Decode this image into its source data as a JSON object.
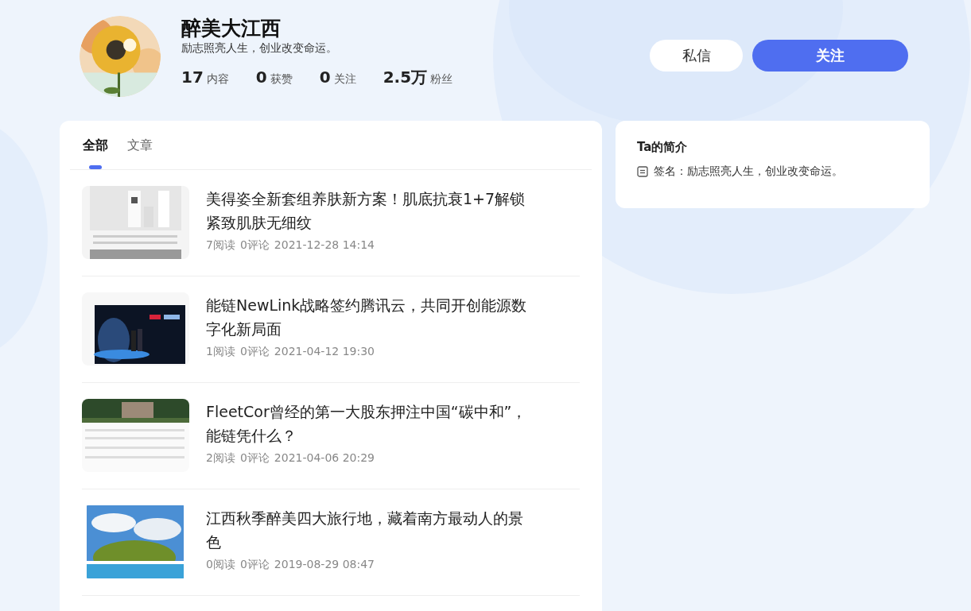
{
  "profile": {
    "name": "醉美大江西",
    "bio": "励志照亮人生，创业改变命运。",
    "stats": [
      {
        "value": "17",
        "label": "内容"
      },
      {
        "value": "0",
        "label": "获赞"
      },
      {
        "value": "0",
        "label": "关注"
      },
      {
        "value": "2.5万",
        "label": "粉丝"
      }
    ],
    "buttons": [
      {
        "label": "私信",
        "kind": "secondary"
      },
      {
        "label": "关注",
        "kind": "primary"
      }
    ]
  },
  "tabs": [
    {
      "label": "全部",
      "selected": true
    },
    {
      "label": "文章",
      "selected": false
    }
  ],
  "articles": [
    {
      "title": "美得姿全新套组养肤新方案！肌底抗衰1+7解锁紧致肌肤无细纹",
      "reads": "7阅读",
      "comments": "0评论",
      "time": "2021-12-28 14:14"
    },
    {
      "title": "能链NewLink战略签约腾讯云，共同开创能源数字化新局面",
      "reads": "1阅读",
      "comments": "0评论",
      "time": "2021-04-12 19:30"
    },
    {
      "title": "FleetCor曾经的第一大股东押注中国“碳中和”，能链凭什么？",
      "reads": "2阅读",
      "comments": "0评论",
      "time": "2021-04-06 20:29"
    },
    {
      "title": "江西秋季醉美四大旅行地，藏着南方最动人的景色",
      "reads": "0阅读",
      "comments": "0评论",
      "time": "2019-08-29 08:47"
    }
  ],
  "intro": {
    "title": "Ta的简介",
    "signature": "签名：励志照亮人生，创业改变命运。"
  }
}
